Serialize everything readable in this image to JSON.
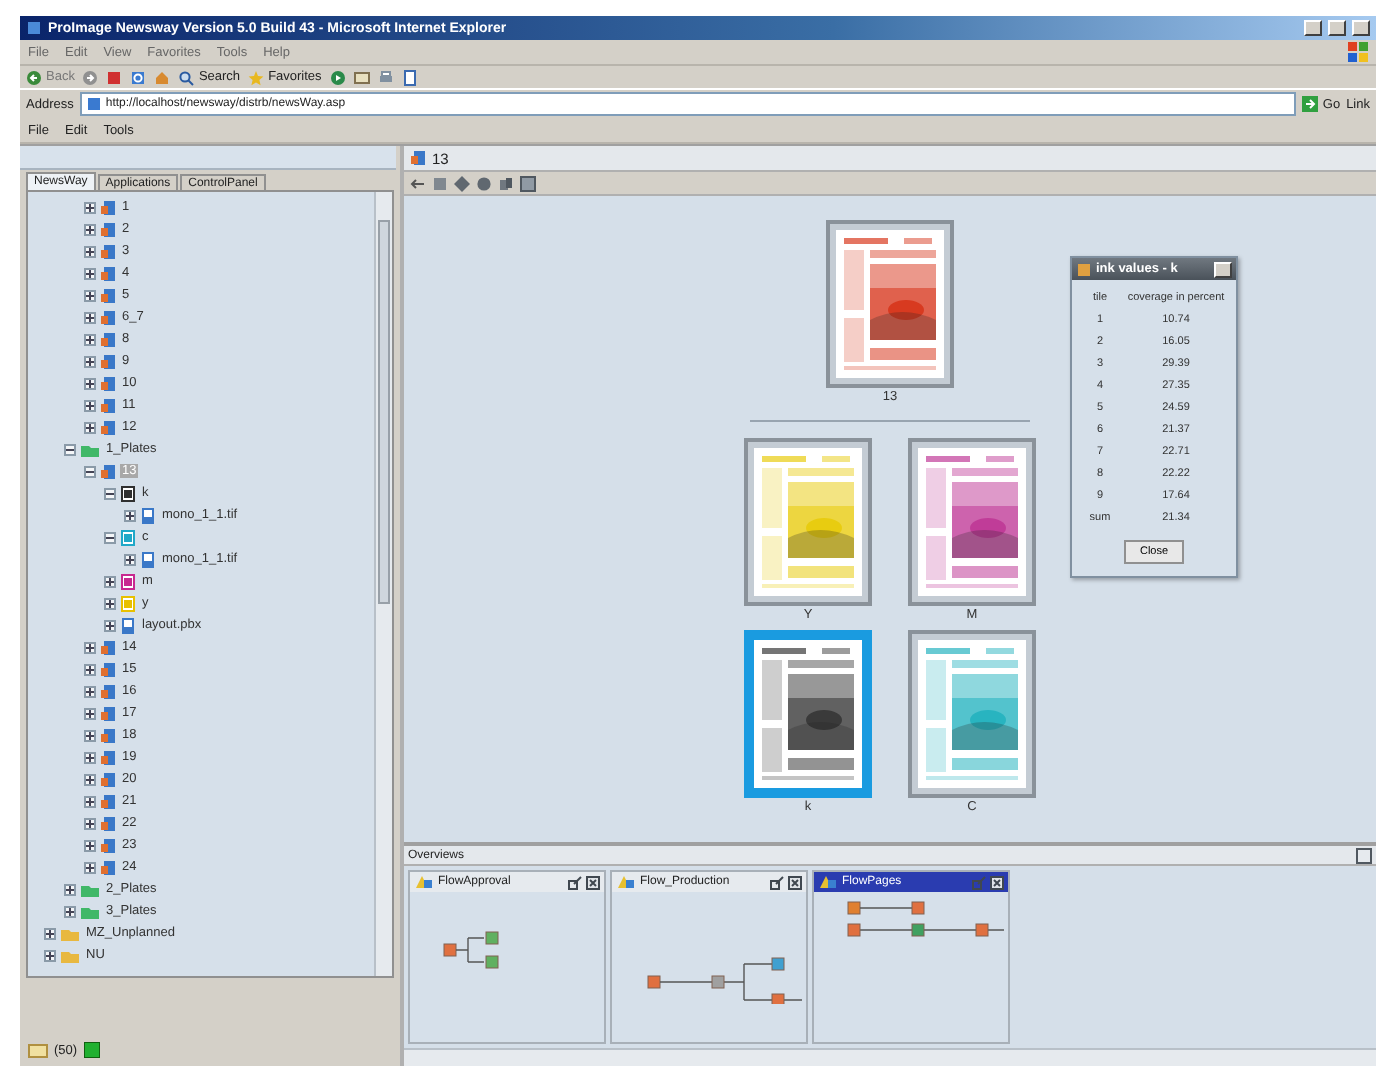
{
  "window": {
    "title": "ProImage Newsway Version 5.0 Build 43 - Microsoft Internet Explorer"
  },
  "browser_menu": [
    "File",
    "Edit",
    "View",
    "Favorites",
    "Tools",
    "Help"
  ],
  "browser_toolbar": [
    {
      "kind": "back",
      "label": "Back"
    },
    {
      "kind": "forward"
    },
    {
      "kind": "stop"
    },
    {
      "kind": "refresh"
    },
    {
      "kind": "home"
    },
    {
      "kind": "search",
      "label": "Search"
    },
    {
      "kind": "favorites",
      "label": "Favorites"
    },
    {
      "kind": "media"
    },
    {
      "kind": "mail"
    },
    {
      "kind": "print"
    },
    {
      "kind": "edit"
    }
  ],
  "address": {
    "label": "Address",
    "value": "http://localhost/newsway/distrb/newsWay.asp",
    "go": "Go",
    "links": "Link"
  },
  "app_menu": [
    "File",
    "Edit",
    "Tools"
  ],
  "left_panel": {
    "tabs": [
      {
        "label": "NewsWay",
        "selected": true
      },
      {
        "label": "Applications",
        "selected": false
      },
      {
        "label": "ControlPanel",
        "selected": false
      }
    ],
    "tree": [
      {
        "children": [
          {
            "children": [
              {
                "label": "1",
                "kind": "page",
                "expanded": false,
                "selected": false
              },
              {
                "label": "2",
                "kind": "page",
                "expanded": false,
                "selected": false
              },
              {
                "label": "3",
                "kind": "page",
                "expanded": false,
                "selected": false
              },
              {
                "label": "4",
                "kind": "page",
                "expanded": false,
                "selected": false
              },
              {
                "label": "5",
                "kind": "page",
                "expanded": false,
                "selected": false
              },
              {
                "label": "6_7",
                "kind": "page",
                "expanded": false,
                "selected": false
              },
              {
                "label": "8",
                "kind": "page",
                "expanded": false,
                "selected": false
              },
              {
                "label": "9",
                "kind": "page",
                "expanded": false,
                "selected": false
              },
              {
                "label": "10",
                "kind": "page",
                "expanded": false,
                "selected": false
              },
              {
                "label": "11",
                "kind": "page",
                "expanded": false,
                "selected": false
              },
              {
                "label": "12",
                "kind": "page",
                "expanded": false,
                "selected": false
              }
            ]
          },
          {
            "label": "1_Plates",
            "kind": "plates",
            "expanded": true,
            "selected": false,
            "children": [
              {
                "label": "13",
                "kind": "page",
                "expanded": true,
                "selected": true,
                "children": [
                  {
                    "label": "k",
                    "kind": "separation",
                    "color": "#303030",
                    "expanded": true,
                    "selected": false,
                    "children": [
                      {
                        "label": "mono_1_1.tif",
                        "kind": "file",
                        "expanded": false,
                        "selected": false
                      }
                    ]
                  },
                  {
                    "label": "c",
                    "kind": "separation",
                    "color": "#20a8c8",
                    "expanded": true,
                    "selected": false,
                    "children": [
                      {
                        "label": "mono_1_1.tif",
                        "kind": "file",
                        "expanded": false,
                        "selected": false
                      }
                    ]
                  },
                  {
                    "label": "m",
                    "kind": "separation",
                    "color": "#c82890",
                    "expanded": false,
                    "selected": false
                  },
                  {
                    "label": "y",
                    "kind": "separation",
                    "color": "#e8c000",
                    "expanded": false,
                    "selected": false
                  },
                  {
                    "label": "layout.pbx",
                    "kind": "file",
                    "expanded": false,
                    "selected": false
                  }
                ]
              },
              {
                "label": "14",
                "kind": "page",
                "expanded": false,
                "selected": false
              },
              {
                "label": "15",
                "kind": "page",
                "expanded": false,
                "selected": false
              },
              {
                "label": "16",
                "kind": "page",
                "expanded": false,
                "selected": false
              },
              {
                "label": "17",
                "kind": "page",
                "expanded": false,
                "selected": false
              },
              {
                "label": "18",
                "kind": "page",
                "expanded": false,
                "selected": false
              },
              {
                "label": "19",
                "kind": "page",
                "expanded": false,
                "selected": false
              },
              {
                "label": "20",
                "kind": "page",
                "expanded": false,
                "selected": false
              },
              {
                "label": "21",
                "kind": "page",
                "expanded": false,
                "selected": false
              },
              {
                "label": "22",
                "kind": "page",
                "expanded": false,
                "selected": false
              },
              {
                "label": "23",
                "kind": "page",
                "expanded": false,
                "selected": false
              },
              {
                "label": "24",
                "kind": "page",
                "expanded": false,
                "selected": false
              }
            ]
          },
          {
            "label": "2_Plates",
            "kind": "plates",
            "expanded": false,
            "selected": false
          },
          {
            "label": "3_Plates",
            "kind": "plates",
            "expanded": false,
            "selected": false
          }
        ]
      },
      {
        "label": "MZ_Unplanned",
        "kind": "folder",
        "expanded": false,
        "selected": false
      },
      {
        "label": "NU",
        "kind": "folder",
        "expanded": false,
        "selected": false
      }
    ],
    "status": {
      "count": "(50)"
    }
  },
  "document": {
    "title": "13",
    "composite": {
      "label": "13",
      "color": "#d83a20",
      "selected": false
    },
    "separations": [
      {
        "label": "Y",
        "color": "#e8cc10",
        "selected": false
      },
      {
        "label": "M",
        "color": "#c03c98",
        "selected": false
      },
      {
        "label": "k",
        "color": "#3a3a3a",
        "selected": true
      },
      {
        "label": "C",
        "color": "#28b4c0",
        "selected": false
      }
    ],
    "ink_dialog": {
      "title": "ink values - k",
      "columns": [
        "tile",
        "coverage in percent"
      ],
      "rows": [
        [
          "1",
          "10.74"
        ],
        [
          "2",
          "16.05"
        ],
        [
          "3",
          "29.39"
        ],
        [
          "4",
          "27.35"
        ],
        [
          "5",
          "24.59"
        ],
        [
          "6",
          "21.37"
        ],
        [
          "7",
          "22.71"
        ],
        [
          "8",
          "22.22"
        ],
        [
          "9",
          "17.64"
        ],
        [
          "sum",
          "21.34"
        ]
      ],
      "button": "Close"
    }
  },
  "overviews": {
    "title": "Overviews",
    "panels": [
      {
        "title": "FlowApproval",
        "kind": "approval",
        "active": false
      },
      {
        "title": "Flow_Production",
        "kind": "production",
        "active": false
      },
      {
        "title": "FlowPages",
        "kind": "pages",
        "active": true
      }
    ]
  }
}
